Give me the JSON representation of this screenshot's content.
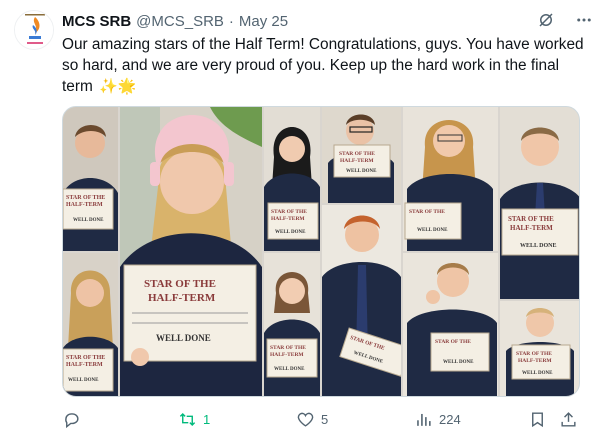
{
  "tweet": {
    "author_name": "MCS SRB",
    "author_handle": "@MCS_SRB",
    "separator": "·",
    "date": "May 25",
    "text": "Our amazing stars of the Half Term! Congratulations, guys. You have worked so hard, and we are very proud of you. Keep up the hard work in the final term",
    "emojis": "✨🌟"
  },
  "icons": {
    "grok": "grok-icon",
    "more": "more-options-icon",
    "reply": "reply-icon",
    "retweet": "retweet-icon",
    "like": "like-icon",
    "views": "views-icon",
    "bookmark": "bookmark-icon",
    "share": "share-icon"
  },
  "actions": {
    "reply_count": "",
    "retweet_count": "1",
    "like_count": "5",
    "view_count": "224"
  },
  "colors": {
    "text": "#0f1419",
    "secondary": "#536471",
    "retweet_active": "#00ba7c",
    "certificate_title": "#8a3b3b"
  },
  "certificates": {
    "line1": "STAR OF THE",
    "line2": "HALF-TERM",
    "well_done": "WELL DONE"
  }
}
